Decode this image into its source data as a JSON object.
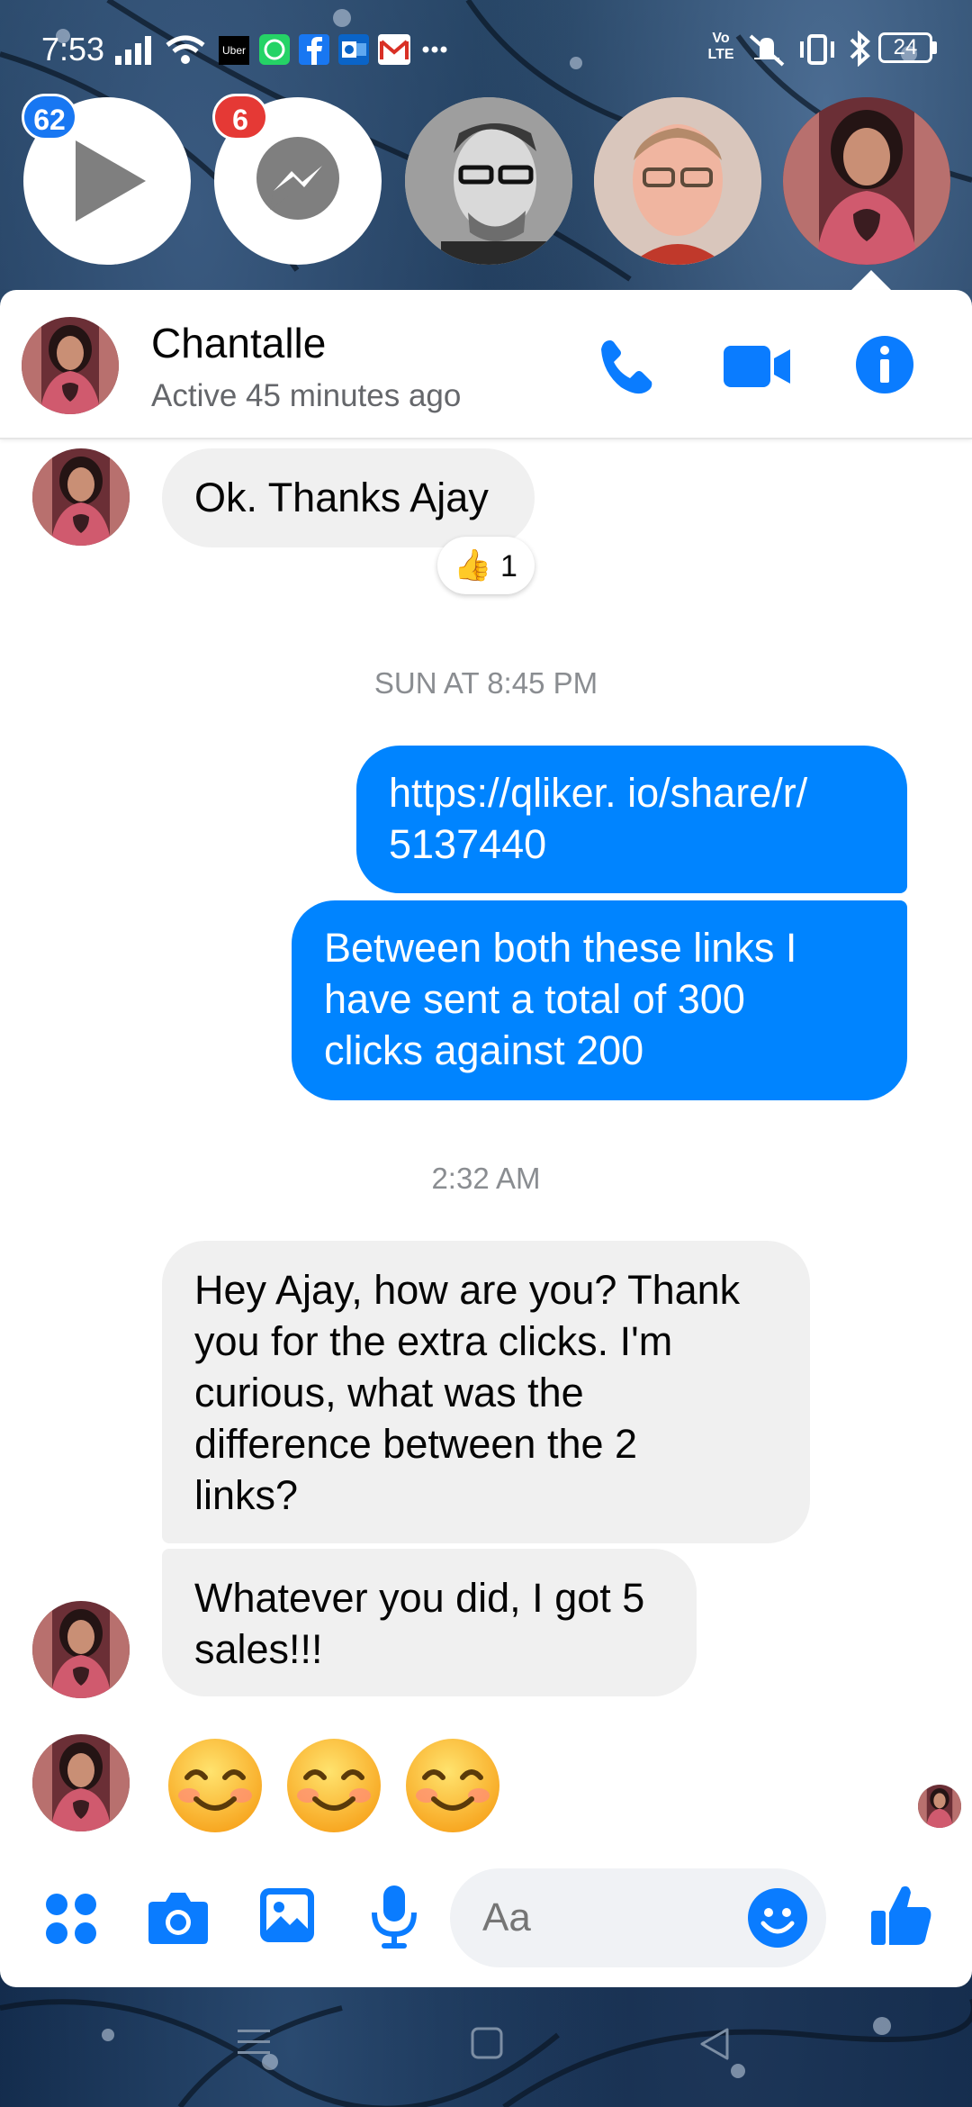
{
  "status_bar": {
    "time": "7:53",
    "battery": "24",
    "volte": "Vo LTE",
    "notification_apps": [
      "uber",
      "whatsapp",
      "facebook",
      "outlook",
      "gmail",
      "more"
    ]
  },
  "chat_heads": {
    "items": [
      {
        "name": "video-play",
        "badge": "62",
        "badge_color": "#1877f2"
      },
      {
        "name": "messenger",
        "badge": "6",
        "badge_color": "#e53935"
      },
      {
        "name": "man-glasses-bw"
      },
      {
        "name": "man-glasses"
      },
      {
        "name": "chantalle",
        "selected": true
      }
    ]
  },
  "header": {
    "contact_name": "Chantalle",
    "contact_status": "Active 45 minutes ago",
    "actions": [
      "phone-icon",
      "video-call-icon",
      "info-icon"
    ]
  },
  "messages": {
    "m1": "Ok. Thanks Ajay",
    "m1_reaction_count": "1",
    "sep1": "SUN AT 8:45 PM",
    "m2": "https://qliker.  io/share/r/\n5137440",
    "m3": "Between both these links I\nhave sent a total of 300\nclicks against 200",
    "sep2": "2:32 AM",
    "m4": "Hey Ajay, how are you? Thank\nyou for the extra clicks. I'm\ncurious, what was the\ndifference between the 2\nlinks?",
    "m5": "Whatever you did, I got 5\nsales!!!",
    "emoji_count": 3
  },
  "composer": {
    "placeholder": "Aa",
    "icons": [
      "apps-icon",
      "camera-icon",
      "gallery-icon",
      "mic-icon",
      "emoji-icon",
      "like-icon"
    ]
  },
  "colors": {
    "brand_blue": "#0084ff",
    "incoming_bubble": "#f0f0f0",
    "icon_blue": "#0a7cff"
  }
}
